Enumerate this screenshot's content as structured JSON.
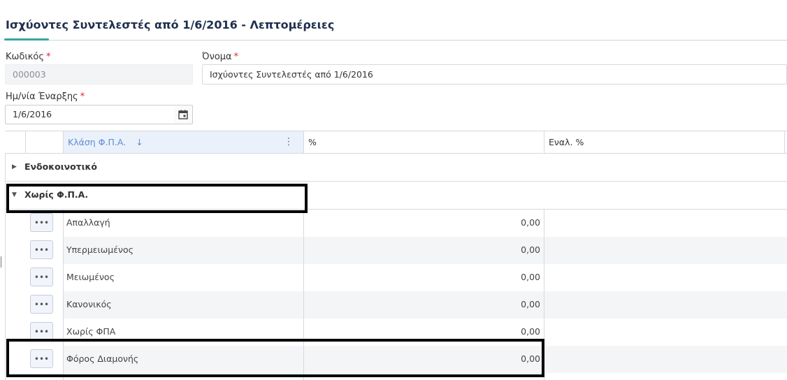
{
  "page": {
    "title": "Ισχύοντες Συντελεστές από 1/6/2016 - Λεπτομέρειες"
  },
  "form": {
    "code": {
      "label": "Κωδικός",
      "required_mark": "*",
      "value": "000003"
    },
    "name": {
      "label": "Όνομα",
      "required_mark": "*",
      "value": "Ισχύοντες Συντελεστές από 1/6/2016"
    },
    "start_date": {
      "label": "Ημ/νία Έναρξης",
      "required_mark": "*",
      "value": "1/6/2016",
      "icon": "calendar-icon"
    }
  },
  "grid": {
    "columns": [
      {
        "label": "Κλάση Φ.Π.Α.",
        "sort_icon": "↓",
        "menu_icon": "⋮"
      },
      {
        "label": "%"
      },
      {
        "label": "Εναλ. %"
      }
    ],
    "groups": [
      {
        "label": "Ενδοκοινοτικό",
        "expanded": false,
        "arrow": "▶"
      },
      {
        "label": "Χωρίς Φ.Π.Α.",
        "expanded": true,
        "arrow": "▼"
      }
    ],
    "row_button_glyph": "•••",
    "rows": [
      {
        "name": "Απαλλαγή",
        "pct": "0,00",
        "alt_pct": ""
      },
      {
        "name": "Υπερμειωμένος",
        "pct": "0,00",
        "alt_pct": ""
      },
      {
        "name": "Μειωμένος",
        "pct": "0,00",
        "alt_pct": ""
      },
      {
        "name": "Κανονικός",
        "pct": "0,00",
        "alt_pct": ""
      },
      {
        "name": "Χωρίς ΦΠΑ",
        "pct": "0,00",
        "alt_pct": ""
      },
      {
        "name": "Φόρος Διαμονής",
        "pct": "0,00",
        "alt_pct": ""
      }
    ]
  },
  "colors": {
    "accent": "#3aa6a4",
    "title": "#1f2f4d",
    "required": "#e0232e",
    "selected_header_text": "#5b8dd6",
    "selected_header_bg": "#ebf1fa",
    "highlight_box": "#000000"
  }
}
